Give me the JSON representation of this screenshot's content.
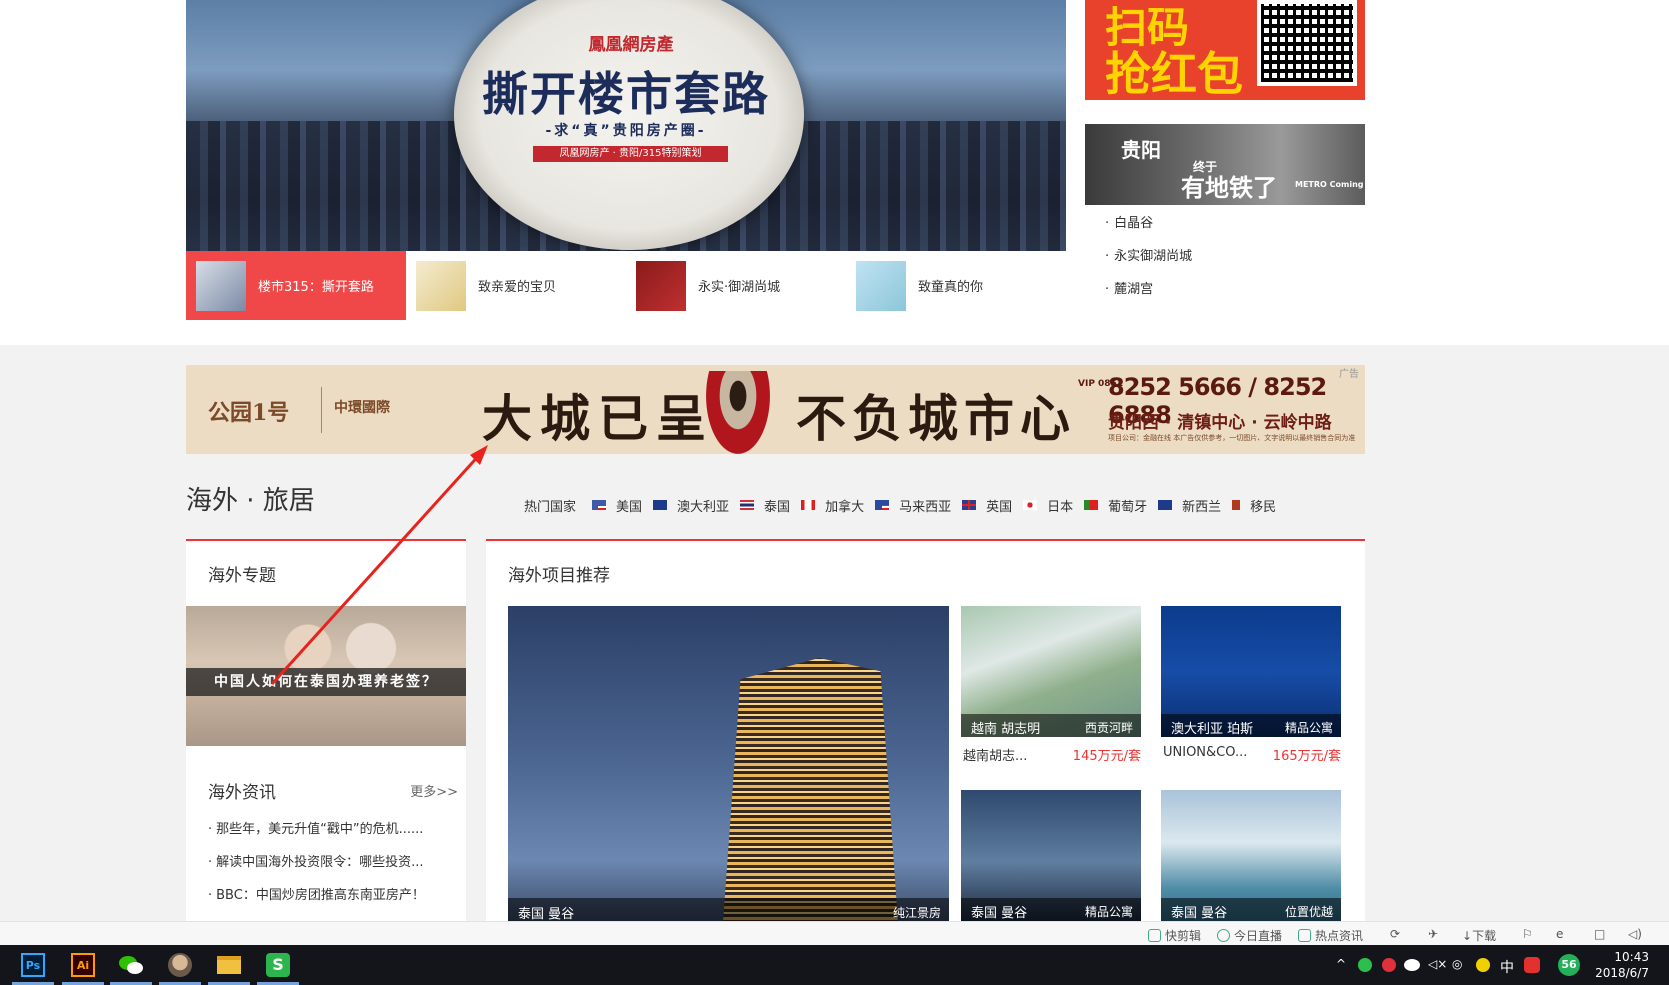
{
  "hero": {
    "brand": "鳳凰網房產",
    "title": "撕开楼市套路",
    "subtitle": "-求“真”贵阳房产圈-",
    "tag": "凤凰网房产 · 贵阳/315特别策划"
  },
  "thumbs": [
    {
      "label": "楼市315：撕开套路",
      "active": true
    },
    {
      "label": "致亲爱的宝贝",
      "active": false
    },
    {
      "label": "永实·御湖尚城",
      "active": false
    },
    {
      "label": "致童真的你",
      "active": false
    }
  ],
  "right_ad": {
    "line1": "扫码",
    "line2": "抢红包"
  },
  "metro_ad": {
    "line1": "贵阳",
    "line2": "有地铁了",
    "line3": "终于",
    "line4": "METRO Coming"
  },
  "right_links": [
    "白晶谷",
    "永实御湖尚城",
    "麓湖宫"
  ],
  "banner": {
    "logo1": "公园1号",
    "logo2": "中環國際",
    "slogan1": "大城已呈",
    "slogan2": "不负城市心",
    "vip": "VIP 0851",
    "phone": "8252 5666 / 8252 6888",
    "address": "贵阳西 · 清镇中心 · 云岭中路",
    "fine": "项目公司：金融在线 本广告仅供参考，一切图片、文字说明以最终销售合同为准",
    "ad_label": "广告"
  },
  "section_title": "海外 · 旅居",
  "countries": {
    "hot_label": "热门国家",
    "items": [
      {
        "name": "美国",
        "flag_color": "#3c5aa6"
      },
      {
        "name": "澳大利亚",
        "flag_color": "#1f3a8a"
      },
      {
        "name": "泰国",
        "flag_color": "#d0303a"
      },
      {
        "name": "加拿大",
        "flag_color": "#e02020"
      },
      {
        "name": "马来西亚",
        "flag_color": "#2a4aa0"
      },
      {
        "name": "英国",
        "flag_color": "#2a3f8f"
      },
      {
        "name": "日本",
        "flag_color": "#e02020"
      },
      {
        "name": "葡萄牙",
        "flag_color": "#2a8a2a"
      },
      {
        "name": "新西兰",
        "flag_color": "#1f3a8a"
      },
      {
        "name": "移民",
        "flag_color": "#b03a20"
      }
    ]
  },
  "left_panel": {
    "title": "海外专题",
    "topic_caption": "中国人如何在泰国办理养老签？",
    "news_title": "海外资讯",
    "more": "更多>>",
    "news": [
      "那些年，美元升值“戳中”的危机......",
      "解读中国海外投资限令：哪些投资...",
      "BBC：中国炒房团推高东南亚房产！"
    ]
  },
  "right_panel": {
    "title": "海外项目推荐",
    "big": {
      "location": "泰国  曼谷",
      "tag": "纯江景房"
    },
    "tiles": [
      {
        "location": "越南  胡志明",
        "tag": "西贡河畔",
        "name": "越南胡志...",
        "price": "145万元/套"
      },
      {
        "location": "澳大利亚  珀斯",
        "tag": "精品公寓",
        "name": "UNION&CO...",
        "price": "165万元/套"
      },
      {
        "location": "泰国  曼谷",
        "tag": "精品公寓"
      },
      {
        "location": "泰国  曼谷",
        "tag": "位置优越"
      }
    ]
  },
  "statusbar": [
    "快剪辑",
    "今日直播",
    "热点资讯",
    "下载"
  ],
  "taskbar": {
    "apps": [
      "Ps",
      "Ai",
      "微信",
      "头像",
      "文件夹",
      "WPS"
    ],
    "ime": "中",
    "badge": "56",
    "time": "10:43",
    "date": "2018/6/7"
  }
}
